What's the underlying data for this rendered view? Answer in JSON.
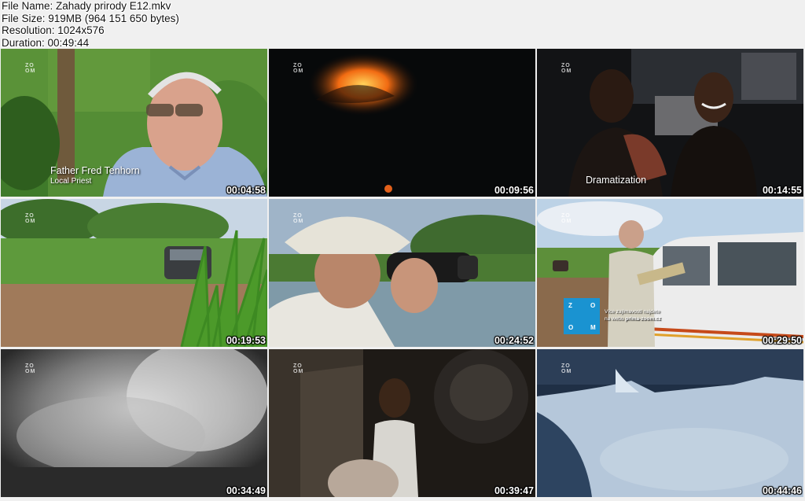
{
  "header": {
    "file_name": "File Name: Zahady prirody E12.mkv",
    "file_size": "File Size: 919MB (964 151 650 bytes)",
    "resolution": "Resolution: 1024x576",
    "duration": "Duration: 00:49:44"
  },
  "logo": {
    "text": "ZO\nOM"
  },
  "thumbnails": [
    {
      "time": "00:04:58",
      "caption": "Father Fred Tenhorn",
      "subcaption": "Local Priest"
    },
    {
      "time": "00:09:56"
    },
    {
      "time": "00:14:55",
      "caption": "Dramatization"
    },
    {
      "time": "00:19:53"
    },
    {
      "time": "00:24:52"
    },
    {
      "time": "00:29:50",
      "promo_line1": "Více zajímavostí najdete",
      "promo_line2a": "na webu ",
      "promo_line2b": "prima-zoom.cz",
      "zoom_letters": [
        "Z",
        "O",
        "O",
        "M"
      ]
    },
    {
      "time": "00:34:49"
    },
    {
      "time": "00:39:47"
    },
    {
      "time": "00:44:46"
    }
  ],
  "colors": {
    "zoom_brand": "#1a93d1",
    "background": "#f0f0f0"
  }
}
